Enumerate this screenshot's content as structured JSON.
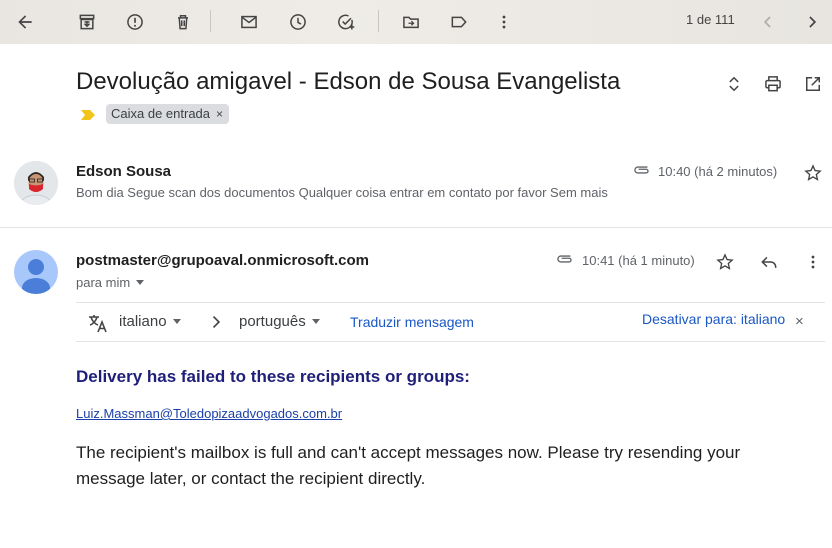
{
  "toolbar": {
    "icons": [
      "back-arrow-icon",
      "archive-icon",
      "report-spam-icon",
      "delete-icon",
      "mark-unread-icon",
      "snooze-icon",
      "add-task-icon",
      "move-to-icon",
      "label-icon",
      "more-vert-icon"
    ],
    "pager_text": "1 de 111"
  },
  "thread": {
    "subject": "Devolução amigavel - Edson de Sousa Evangelista",
    "label_chip": "Caixa de entrada",
    "label_remove": "×"
  },
  "messages": [
    {
      "sender": "Edson Sousa",
      "time": "10:40 (há 2 minutos)",
      "snippet": "Bom dia Segue scan dos documentos Qualquer coisa entrar em contato por favor Sem mais"
    },
    {
      "sender": "postmaster@grupoaval.onmicrosoft.com",
      "time": "10:41 (há 1 minuto)",
      "to": "para mim"
    }
  ],
  "translate": {
    "source_lang": "italiano",
    "target_lang": "português",
    "translate_link": "Traduzir mensagem",
    "disable_link": "Desativar para: italiano",
    "close": "×"
  },
  "body": {
    "title": "Delivery has failed to these recipients or groups:",
    "recipient": "Luiz.Massman@Toledopizaadvogados.com.br",
    "text": "The recipient's mailbox is full and can't accept messages now. Please try resending your message later, or contact the recipient directly."
  },
  "colors": {
    "accent_link": "#1a57c5",
    "body_title": "#1f1f7a",
    "importance_marker": "#f2c318",
    "avatar_default": "#a8c7fa"
  }
}
